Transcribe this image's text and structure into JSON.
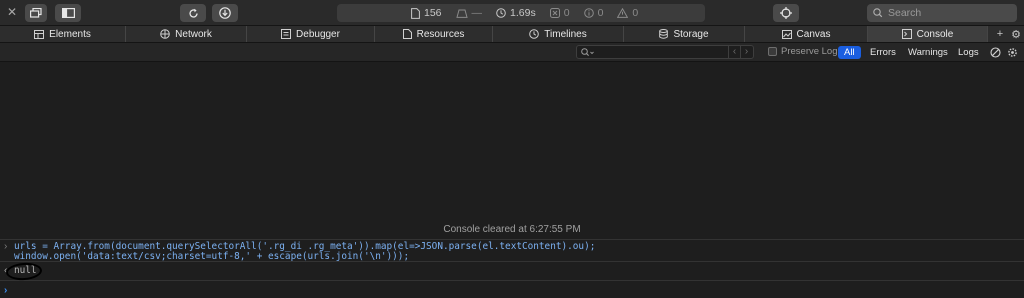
{
  "toolbar": {
    "status": {
      "resources": "156",
      "transferred": "—",
      "load_time": "1.69s",
      "errors": "0",
      "warnings": "0",
      "logs": "0"
    },
    "search_placeholder": "Search"
  },
  "tabs": [
    {
      "label": "Elements",
      "icon": "elements-icon"
    },
    {
      "label": "Network",
      "icon": "network-icon"
    },
    {
      "label": "Debugger",
      "icon": "debugger-icon"
    },
    {
      "label": "Resources",
      "icon": "resources-icon"
    },
    {
      "label": "Timelines",
      "icon": "timelines-icon"
    },
    {
      "label": "Storage",
      "icon": "storage-icon"
    },
    {
      "label": "Canvas",
      "icon": "canvas-icon"
    },
    {
      "label": "Console",
      "icon": "console-icon",
      "active": true
    }
  ],
  "filter": {
    "placeholder": "",
    "preserve_log": "Preserve Log",
    "levels": [
      "All",
      "Errors",
      "Warnings",
      "Logs"
    ],
    "active_level": "All"
  },
  "console": {
    "cleared_message": "Console cleared at 6:27:55 PM",
    "input_lines": [
      "urls = Array.from(document.querySelectorAll('.rg_di .rg_meta')).map(el=>JSON.parse(el.textContent).ou);",
      "window.open('data:text/csv;charset=utf-8,' + escape(urls.join('\\n')));"
    ],
    "output": "null"
  },
  "colors": {
    "accent": "#1a5ee0",
    "code": "#7cb1f2",
    "background": "#1e1e1e"
  }
}
